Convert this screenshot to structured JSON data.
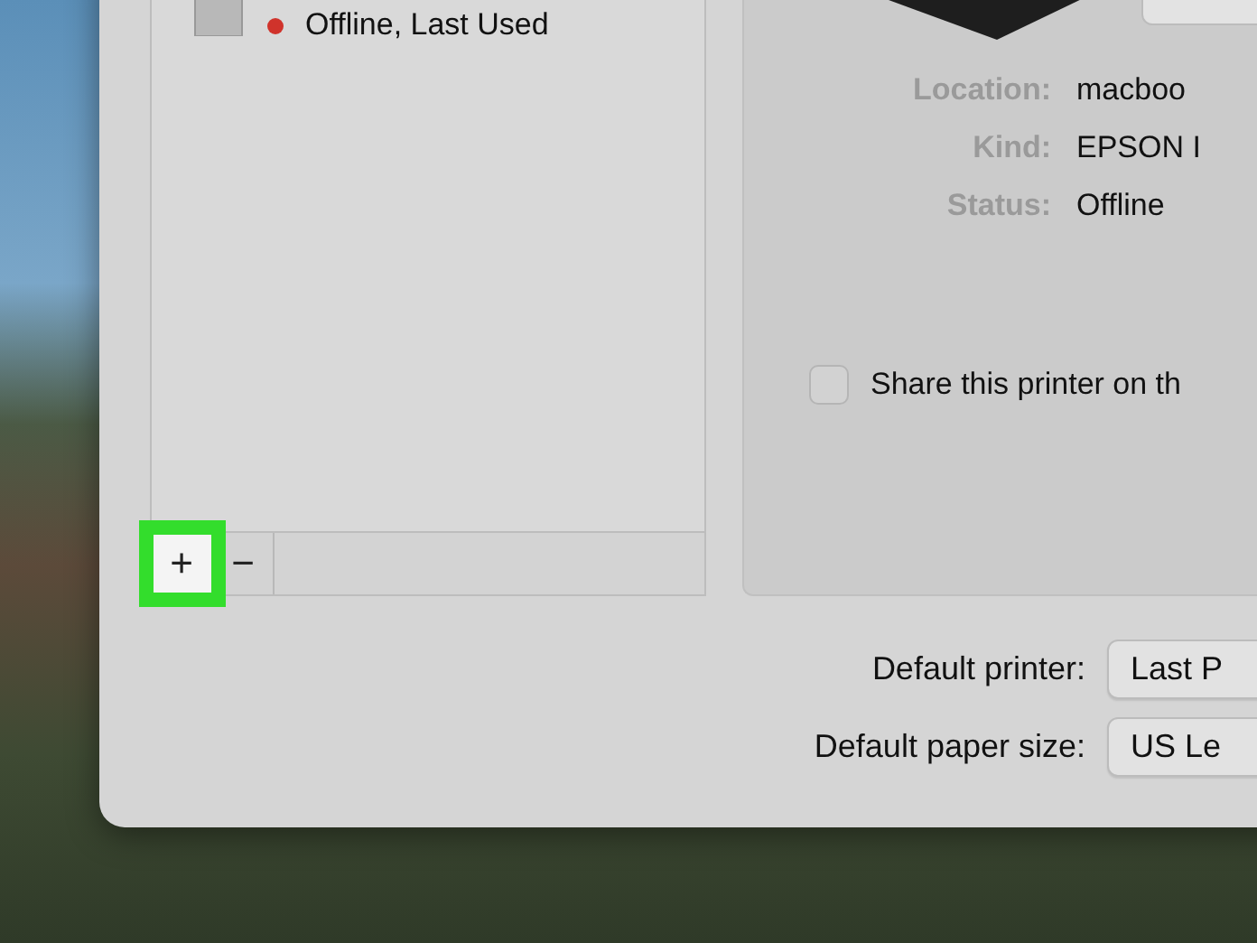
{
  "printer_list": {
    "items": [
      {
        "status": "Offline, Last Used",
        "color": "#d0332b"
      }
    ],
    "buttons": [
      {
        "label": "+",
        "highlighted": true
      },
      {
        "label": "−",
        "highlighted": false
      }
    ]
  },
  "details": {
    "fields": [
      {
        "label": "Location:",
        "value": "macboo"
      },
      {
        "label": "Kind:",
        "value": "EPSON I"
      },
      {
        "label": "Status:",
        "value": "Offline"
      }
    ],
    "share": {
      "label": "Share this printer on th",
      "checked": false
    }
  },
  "defaults": [
    {
      "label": "Default printer:",
      "value": "Last P"
    },
    {
      "label": "Default paper size:",
      "value": "US Le"
    }
  ]
}
